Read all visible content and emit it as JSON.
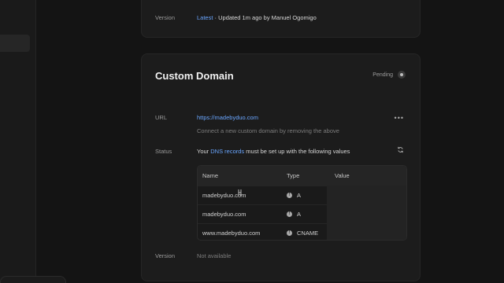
{
  "top_card": {
    "version_label": "Version",
    "version_link": "Latest",
    "version_detail": "· Updated 1m ago by Manuel Ogomigo"
  },
  "main_card": {
    "title": "Custom Domain",
    "status_badge": "Pending",
    "url_label": "URL",
    "url_value": "https://madebyduo.com",
    "url_hint": "Connect a new custom domain by removing the above",
    "status_label": "Status",
    "status_prefix": "Your",
    "status_link": "DNS records",
    "status_suffix": "must be set up with the following values",
    "version_label": "Version",
    "version_value": "Not available"
  },
  "dns_table": {
    "columns": [
      "Name",
      "Type",
      "Value"
    ],
    "rows": [
      {
        "name": "madebyduo.com",
        "type": "A"
      },
      {
        "name": "madebyduo.com",
        "type": "A"
      },
      {
        "name": "www.madebyduo.com",
        "type": "CNAME"
      }
    ]
  },
  "icons": {
    "more": "more-horizontal-icon",
    "refresh": "refresh-icon",
    "info": "info-icon",
    "status": "pending-dot-icon"
  },
  "colors": {
    "background": "#141414",
    "card": "#1c1c1c",
    "link": "#6aa6ff",
    "text": "#d8d8d8",
    "muted": "#7d7d7d"
  }
}
